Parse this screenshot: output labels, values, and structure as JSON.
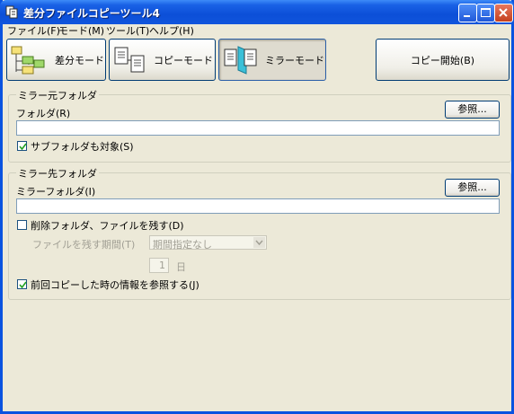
{
  "window": {
    "title": "差分ファイルコピーツール4"
  },
  "menu": [
    {
      "label": "ファイル(F)"
    },
    {
      "label": "モード(M)"
    },
    {
      "label": "ツール(T)"
    },
    {
      "label": "ヘルプ(H)"
    }
  ],
  "toolbar": {
    "diff_mode": "差分モード",
    "copy_mode": "コピーモード",
    "mirror_mode": "ミラーモード",
    "start_copy": "コピー開始(B)",
    "active": "mirror_mode"
  },
  "source": {
    "group_title": "ミラー元フォルダ",
    "folder_label": "フォルダ(R)",
    "folder_value": "",
    "browse_label": "参照...",
    "subfolders_label": "サブフォルダも対象(S)",
    "subfolders_checked": true
  },
  "dest": {
    "group_title": "ミラー先フォルダ",
    "folder_label": "ミラーフォルダ(I)",
    "folder_value": "",
    "browse_label": "参照...",
    "keep_deleted_label": "削除フォルダ、ファイルを残す(D)",
    "keep_deleted_checked": false,
    "keep_period_label": "ファイルを残す期間(T)",
    "keep_period_value": "期間指定なし",
    "days_value": "1",
    "days_unit": "日",
    "use_prev_info_label": "前回コピーした時の情報を参照する(J)",
    "use_prev_info_checked": true
  },
  "colors": {
    "titlebar": "#0c4fd8",
    "face": "#ece9d8",
    "mirror_accent": "#3bc0d8"
  }
}
